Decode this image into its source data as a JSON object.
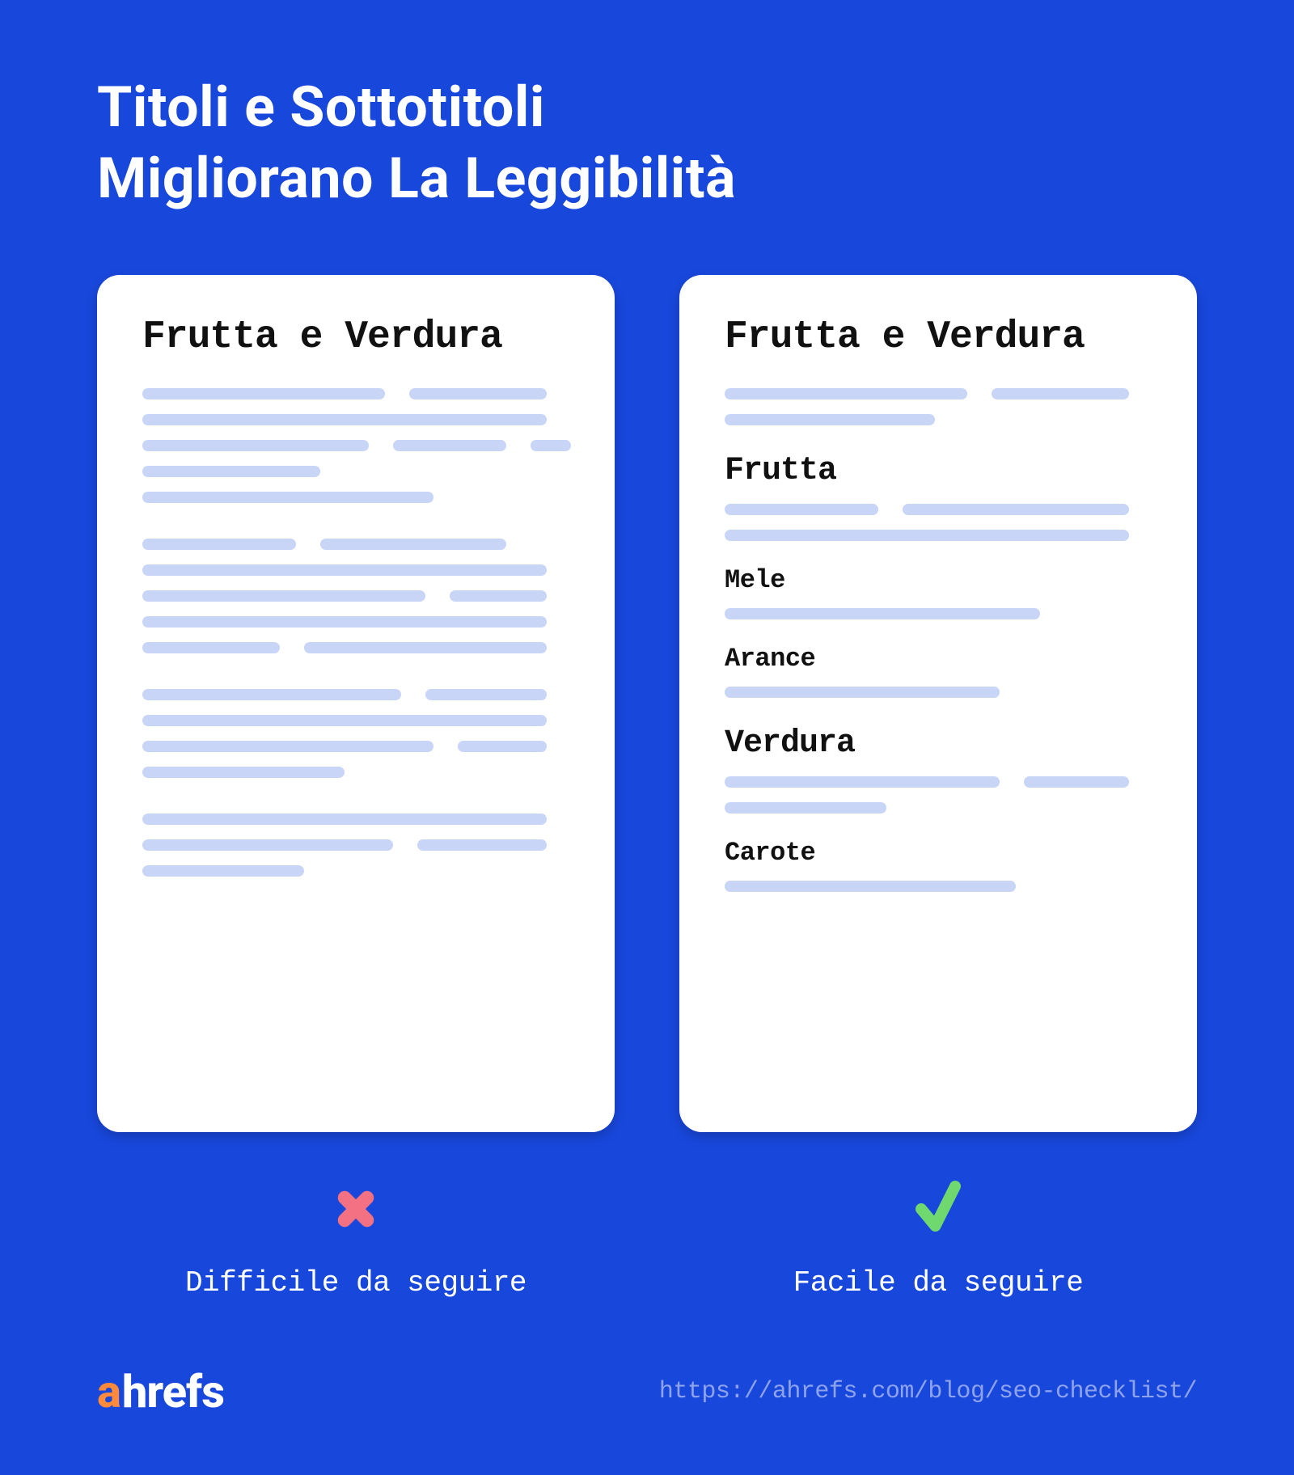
{
  "title_line1": "Titoli e Sottotitoli",
  "title_line2": "Migliorano La Leggibilità",
  "left": {
    "heading": "Frutta e Verdura",
    "caption": "Difficile da seguire"
  },
  "right": {
    "heading": "Frutta e Verdura",
    "sections": {
      "frutta": "Frutta",
      "mele": "Mele",
      "arance": "Arance",
      "verdura": "Verdura",
      "carote": "Carote"
    },
    "caption": "Facile da seguire"
  },
  "footer": {
    "brand_a": "a",
    "brand_rest": "hrefs",
    "url": "https://ahrefs.com/blog/seo-checklist/"
  },
  "colors": {
    "background": "#1847db",
    "card": "#ffffff",
    "placeholder": "#c8d5f6",
    "cross": "#f47184",
    "check": "#6fd96f",
    "logo_accent": "#ff8a3c"
  }
}
